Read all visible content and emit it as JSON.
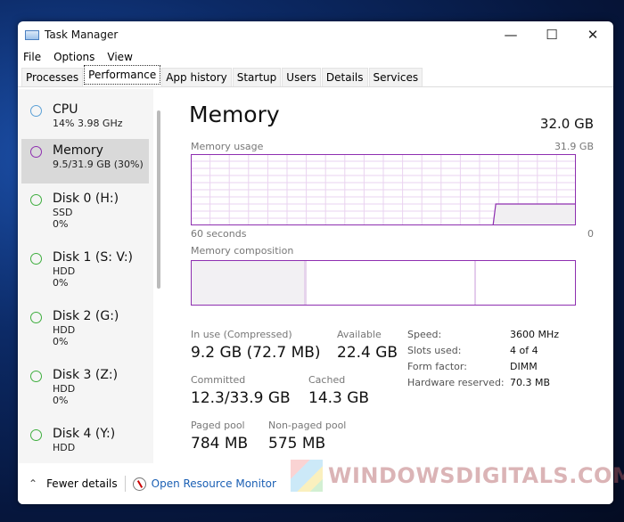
{
  "window": {
    "title": "Task Manager",
    "minimize": "—",
    "maximize": "☐",
    "close": "✕"
  },
  "menu": [
    "File",
    "Options",
    "View"
  ],
  "tabs": [
    "Processes",
    "Performance",
    "App history",
    "Startup",
    "Users",
    "Details",
    "Services"
  ],
  "active_tab": "Performance",
  "sidebar": [
    {
      "name": "CPU",
      "l1": "14%  3.98 GHz",
      "l2": ""
    },
    {
      "name": "Memory",
      "l1": "9.5/31.9 GB (30%)",
      "l2": ""
    },
    {
      "name": "Disk 0 (H:)",
      "l1": "SSD",
      "l2": "0%"
    },
    {
      "name": "Disk 1 (S: V:)",
      "l1": "HDD",
      "l2": "0%"
    },
    {
      "name": "Disk 2 (G:)",
      "l1": "HDD",
      "l2": "0%"
    },
    {
      "name": "Disk 3 (Z:)",
      "l1": "HDD",
      "l2": "0%"
    },
    {
      "name": "Disk 4 (Y:)",
      "l1": "HDD",
      "l2": ""
    }
  ],
  "main": {
    "title": "Memory",
    "total": "32.0 GB",
    "usage_label": "Memory usage",
    "usage_max": "31.9 GB",
    "axis_left": "60 seconds",
    "axis_right": "0",
    "composition_label": "Memory composition",
    "stats": {
      "in_use_label": "In use (Compressed)",
      "in_use": "9.2 GB (72.7 MB)",
      "available_label": "Available",
      "available": "22.4 GB",
      "committed_label": "Committed",
      "committed": "12.3/33.9 GB",
      "cached_label": "Cached",
      "cached": "14.3 GB",
      "paged_label": "Paged pool",
      "paged": "784 MB",
      "nonpaged_label": "Non-paged pool",
      "nonpaged": "575 MB"
    },
    "specs": [
      {
        "k": "Speed:",
        "v": "3600 MHz"
      },
      {
        "k": "Slots used:",
        "v": "4 of 4"
      },
      {
        "k": "Form factor:",
        "v": "DIMM"
      },
      {
        "k": "Hardware reserved:",
        "v": "70.3 MB"
      }
    ],
    "usage_percent": 30,
    "accent": "#8e2fb0"
  },
  "footer": {
    "fewer": "Fewer details",
    "resmon": "Open Resource Monitor"
  },
  "watermark": "WindowsDigitals.com"
}
